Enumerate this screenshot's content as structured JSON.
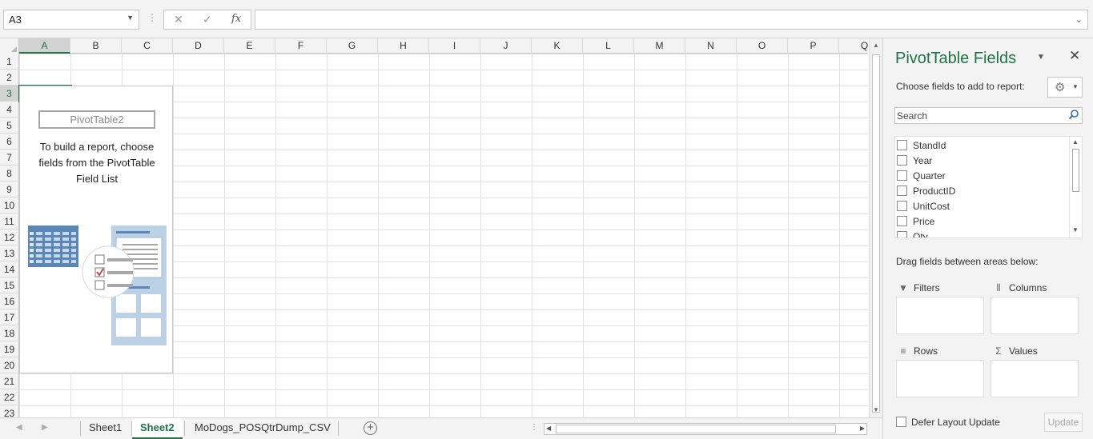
{
  "formula_bar": {
    "name_box": "A3",
    "formula": "",
    "cancel_symbol": "✕",
    "enter_symbol": "✓",
    "fx_symbol": "fx"
  },
  "grid": {
    "columns": [
      "A",
      "B",
      "C",
      "D",
      "E",
      "F",
      "G",
      "H",
      "I",
      "J",
      "K",
      "L",
      "M",
      "N",
      "O",
      "P",
      "Q"
    ],
    "rows": [
      "1",
      "2",
      "3",
      "4",
      "5",
      "6",
      "7",
      "8",
      "9",
      "10",
      "11",
      "12",
      "13",
      "14",
      "15",
      "16",
      "17",
      "18",
      "19",
      "20",
      "21",
      "22",
      "23"
    ],
    "selected_cell": "A3"
  },
  "pivot_placeholder": {
    "name": "PivotTable2",
    "message": "To build a report, choose fields from the PivotTable Field List"
  },
  "sheet_tabs": {
    "tabs": [
      "Sheet1",
      "Sheet2",
      "MoDogs_POSQtrDump_CSV"
    ],
    "active": "Sheet2",
    "add_symbol": "+"
  },
  "pivot_fields_pane": {
    "title": "PivotTable Fields",
    "subtitle": "Choose fields to add to report:",
    "search_placeholder": "Search",
    "fields": [
      "StandId",
      "Year",
      "Quarter",
      "ProductID",
      "UnitCost",
      "Price",
      "Qty"
    ],
    "drag_message": "Drag fields between areas below:",
    "areas": {
      "filters": "Filters",
      "columns": "Columns",
      "rows": "Rows",
      "values": "Values"
    },
    "area_icons": {
      "filters": "▼",
      "columns": "⦀",
      "rows": "≡",
      "values": "Σ"
    },
    "defer_label": "Defer Layout Update",
    "update_label": "Update"
  },
  "colors": {
    "accent": "#217346",
    "gridline": "#e1e1e1",
    "header_bg": "#f3f3f3"
  }
}
